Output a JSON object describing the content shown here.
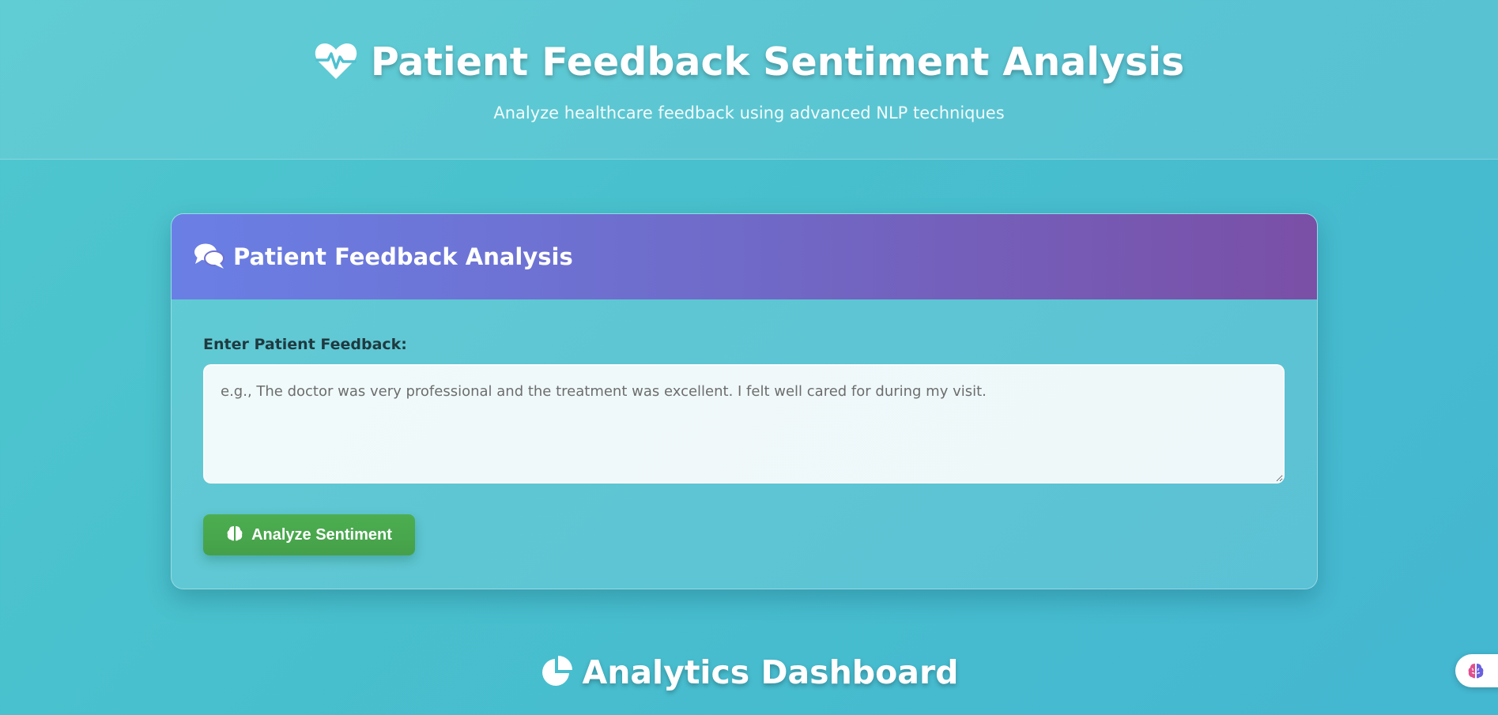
{
  "header": {
    "title": "Patient Feedback Sentiment Analysis",
    "subtitle": "Analyze healthcare feedback using advanced NLP techniques",
    "icon": "heartbeat-icon"
  },
  "feedback_card": {
    "title": "Patient Feedback Analysis",
    "icon": "comments-icon",
    "header_gradient": [
      "#6a7fe5",
      "#7a4fa6"
    ],
    "input_label": "Enter Patient Feedback:",
    "input_value": "",
    "input_placeholder": "e.g., The doctor was very professional and the treatment was excellent. I felt well cared for during my visit.",
    "button_label": "Analyze Sentiment",
    "button_icon": "brain-icon",
    "button_color": "#4cae50"
  },
  "dashboard": {
    "title": "Analytics Dashboard",
    "icon": "pie-chart-icon"
  },
  "floating_widget": {
    "icon": "brain-icon"
  },
  "colors": {
    "background": "#48bfcd",
    "text_light": "#ffffff",
    "label_dark": "#1f3a40"
  }
}
